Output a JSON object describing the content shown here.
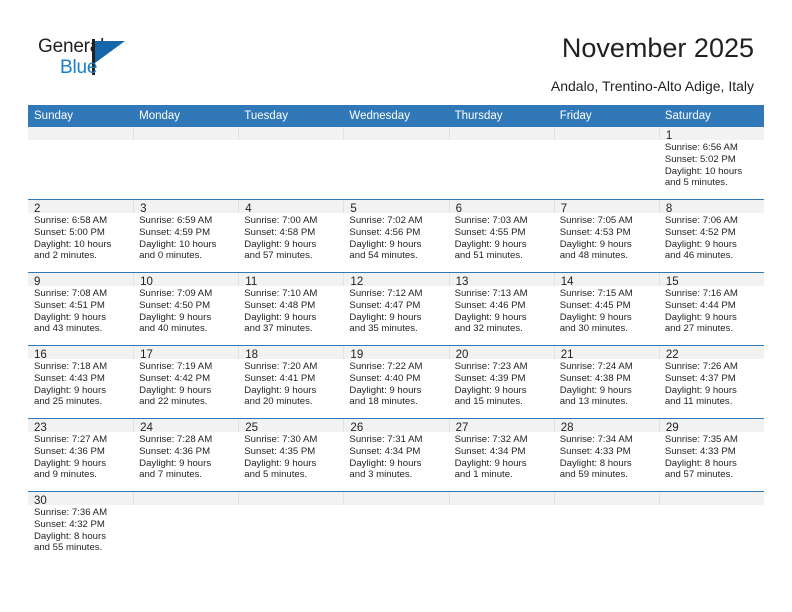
{
  "brand": {
    "name_part1": "General",
    "name_part2": "Blue",
    "logo_icon": "blue-triangle-icon",
    "accent_color": "#1566a8"
  },
  "header": {
    "title": "November 2025",
    "subtitle": "Andalo, Trentino-Alto Adige, Italy",
    "header_bg_color": "#3178b9",
    "daynum_bg_color": "#f2f2f2"
  },
  "calendar": {
    "weekday_headers": [
      "Sunday",
      "Monday",
      "Tuesday",
      "Wednesday",
      "Thursday",
      "Friday",
      "Saturday"
    ],
    "weeks": [
      [
        {
          "day": "",
          "lines": []
        },
        {
          "day": "",
          "lines": []
        },
        {
          "day": "",
          "lines": []
        },
        {
          "day": "",
          "lines": []
        },
        {
          "day": "",
          "lines": []
        },
        {
          "day": "",
          "lines": []
        },
        {
          "day": "1",
          "lines": [
            "Sunrise: 6:56 AM",
            "Sunset: 5:02 PM",
            "Daylight: 10 hours",
            "and 5 minutes."
          ]
        }
      ],
      [
        {
          "day": "2",
          "lines": [
            "Sunrise: 6:58 AM",
            "Sunset: 5:00 PM",
            "Daylight: 10 hours",
            "and 2 minutes."
          ]
        },
        {
          "day": "3",
          "lines": [
            "Sunrise: 6:59 AM",
            "Sunset: 4:59 PM",
            "Daylight: 10 hours",
            "and 0 minutes."
          ]
        },
        {
          "day": "4",
          "lines": [
            "Sunrise: 7:00 AM",
            "Sunset: 4:58 PM",
            "Daylight: 9 hours",
            "and 57 minutes."
          ]
        },
        {
          "day": "5",
          "lines": [
            "Sunrise: 7:02 AM",
            "Sunset: 4:56 PM",
            "Daylight: 9 hours",
            "and 54 minutes."
          ]
        },
        {
          "day": "6",
          "lines": [
            "Sunrise: 7:03 AM",
            "Sunset: 4:55 PM",
            "Daylight: 9 hours",
            "and 51 minutes."
          ]
        },
        {
          "day": "7",
          "lines": [
            "Sunrise: 7:05 AM",
            "Sunset: 4:53 PM",
            "Daylight: 9 hours",
            "and 48 minutes."
          ]
        },
        {
          "day": "8",
          "lines": [
            "Sunrise: 7:06 AM",
            "Sunset: 4:52 PM",
            "Daylight: 9 hours",
            "and 46 minutes."
          ]
        }
      ],
      [
        {
          "day": "9",
          "lines": [
            "Sunrise: 7:08 AM",
            "Sunset: 4:51 PM",
            "Daylight: 9 hours",
            "and 43 minutes."
          ]
        },
        {
          "day": "10",
          "lines": [
            "Sunrise: 7:09 AM",
            "Sunset: 4:50 PM",
            "Daylight: 9 hours",
            "and 40 minutes."
          ]
        },
        {
          "day": "11",
          "lines": [
            "Sunrise: 7:10 AM",
            "Sunset: 4:48 PM",
            "Daylight: 9 hours",
            "and 37 minutes."
          ]
        },
        {
          "day": "12",
          "lines": [
            "Sunrise: 7:12 AM",
            "Sunset: 4:47 PM",
            "Daylight: 9 hours",
            "and 35 minutes."
          ]
        },
        {
          "day": "13",
          "lines": [
            "Sunrise: 7:13 AM",
            "Sunset: 4:46 PM",
            "Daylight: 9 hours",
            "and 32 minutes."
          ]
        },
        {
          "day": "14",
          "lines": [
            "Sunrise: 7:15 AM",
            "Sunset: 4:45 PM",
            "Daylight: 9 hours",
            "and 30 minutes."
          ]
        },
        {
          "day": "15",
          "lines": [
            "Sunrise: 7:16 AM",
            "Sunset: 4:44 PM",
            "Daylight: 9 hours",
            "and 27 minutes."
          ]
        }
      ],
      [
        {
          "day": "16",
          "lines": [
            "Sunrise: 7:18 AM",
            "Sunset: 4:43 PM",
            "Daylight: 9 hours",
            "and 25 minutes."
          ]
        },
        {
          "day": "17",
          "lines": [
            "Sunrise: 7:19 AM",
            "Sunset: 4:42 PM",
            "Daylight: 9 hours",
            "and 22 minutes."
          ]
        },
        {
          "day": "18",
          "lines": [
            "Sunrise: 7:20 AM",
            "Sunset: 4:41 PM",
            "Daylight: 9 hours",
            "and 20 minutes."
          ]
        },
        {
          "day": "19",
          "lines": [
            "Sunrise: 7:22 AM",
            "Sunset: 4:40 PM",
            "Daylight: 9 hours",
            "and 18 minutes."
          ]
        },
        {
          "day": "20",
          "lines": [
            "Sunrise: 7:23 AM",
            "Sunset: 4:39 PM",
            "Daylight: 9 hours",
            "and 15 minutes."
          ]
        },
        {
          "day": "21",
          "lines": [
            "Sunrise: 7:24 AM",
            "Sunset: 4:38 PM",
            "Daylight: 9 hours",
            "and 13 minutes."
          ]
        },
        {
          "day": "22",
          "lines": [
            "Sunrise: 7:26 AM",
            "Sunset: 4:37 PM",
            "Daylight: 9 hours",
            "and 11 minutes."
          ]
        }
      ],
      [
        {
          "day": "23",
          "lines": [
            "Sunrise: 7:27 AM",
            "Sunset: 4:36 PM",
            "Daylight: 9 hours",
            "and 9 minutes."
          ]
        },
        {
          "day": "24",
          "lines": [
            "Sunrise: 7:28 AM",
            "Sunset: 4:36 PM",
            "Daylight: 9 hours",
            "and 7 minutes."
          ]
        },
        {
          "day": "25",
          "lines": [
            "Sunrise: 7:30 AM",
            "Sunset: 4:35 PM",
            "Daylight: 9 hours",
            "and 5 minutes."
          ]
        },
        {
          "day": "26",
          "lines": [
            "Sunrise: 7:31 AM",
            "Sunset: 4:34 PM",
            "Daylight: 9 hours",
            "and 3 minutes."
          ]
        },
        {
          "day": "27",
          "lines": [
            "Sunrise: 7:32 AM",
            "Sunset: 4:34 PM",
            "Daylight: 9 hours",
            "and 1 minute."
          ]
        },
        {
          "day": "28",
          "lines": [
            "Sunrise: 7:34 AM",
            "Sunset: 4:33 PM",
            "Daylight: 8 hours",
            "and 59 minutes."
          ]
        },
        {
          "day": "29",
          "lines": [
            "Sunrise: 7:35 AM",
            "Sunset: 4:33 PM",
            "Daylight: 8 hours",
            "and 57 minutes."
          ]
        }
      ],
      [
        {
          "day": "30",
          "lines": [
            "Sunrise: 7:36 AM",
            "Sunset: 4:32 PM",
            "Daylight: 8 hours",
            "and 55 minutes."
          ]
        },
        {
          "day": "",
          "lines": []
        },
        {
          "day": "",
          "lines": []
        },
        {
          "day": "",
          "lines": []
        },
        {
          "day": "",
          "lines": []
        },
        {
          "day": "",
          "lines": []
        },
        {
          "day": "",
          "lines": []
        }
      ]
    ]
  }
}
